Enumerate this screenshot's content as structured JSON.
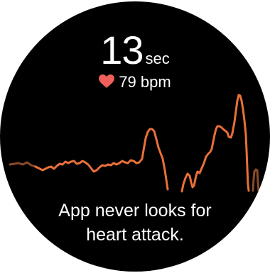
{
  "timer": {
    "value": "13",
    "unit": "sec"
  },
  "heart_rate": {
    "icon": "heart-icon",
    "text": "79 bpm"
  },
  "colors": {
    "waveform": "#e8703a",
    "waveform_faded": "#8a4a2a",
    "heart": "#f0605a",
    "background": "#000000",
    "text": "#ffffff"
  },
  "message": {
    "line1": "App never looks for",
    "line2": "heart attack."
  }
}
